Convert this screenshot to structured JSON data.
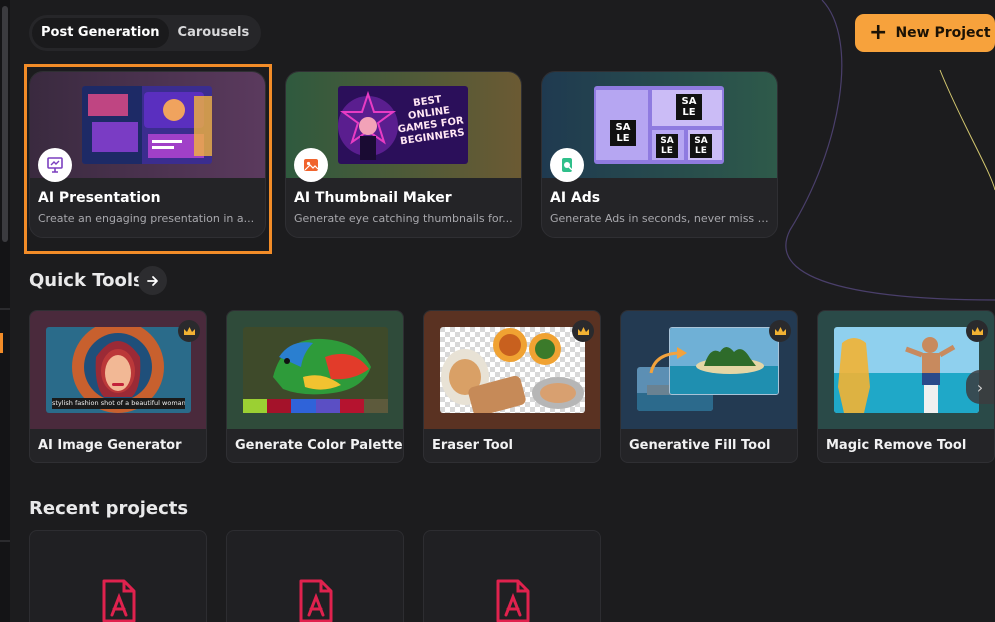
{
  "header": {
    "tabs": [
      {
        "label": "Post Generation",
        "active": true
      },
      {
        "label": "Carousels",
        "active": false
      }
    ],
    "new_project_label": "New Project",
    "new_project_icon": "plus-icon"
  },
  "features": [
    {
      "title": "AI Presentation",
      "description": "Create an engaging presentation in a...",
      "icon": "presentation-icon",
      "selected": true
    },
    {
      "title": "AI Thumbnail Maker",
      "description": "Generate eye catching thumbnails for...",
      "icon": "image-icon",
      "thumb_text": "BEST ONLINE GAMES FOR BEGINNERS"
    },
    {
      "title": "AI Ads",
      "description": "Generate Ads in seconds, never miss a...",
      "icon": "ad-icon",
      "thumb_text": [
        "SA LE",
        "SA LE",
        "SA LE",
        "SA LE"
      ]
    }
  ],
  "quick_tools": {
    "title": "Quick Tools",
    "items": [
      {
        "label": "AI Image Generator",
        "premium": true,
        "caption": "stylish fashion shot of a beautiful woman"
      },
      {
        "label": "Generate Color Palette",
        "premium": false,
        "palette": [
          "#9bd033",
          "#a4122a",
          "#2f63d9",
          "#5b4fc4",
          "#b5132f",
          "#5d5a3c"
        ]
      },
      {
        "label": "Eraser Tool",
        "premium": true
      },
      {
        "label": "Generative Fill Tool",
        "premium": true
      },
      {
        "label": "Magic Remove Tool",
        "premium": true
      }
    ]
  },
  "recent": {
    "title": "Recent projects",
    "items": [
      {
        "icon": "file-pen-icon"
      },
      {
        "icon": "file-pen-icon"
      },
      {
        "icon": "file-pen-icon"
      }
    ]
  },
  "colors": {
    "accent": "#f7a23c",
    "selection": "#f28c28",
    "background": "#1c1c1e"
  }
}
